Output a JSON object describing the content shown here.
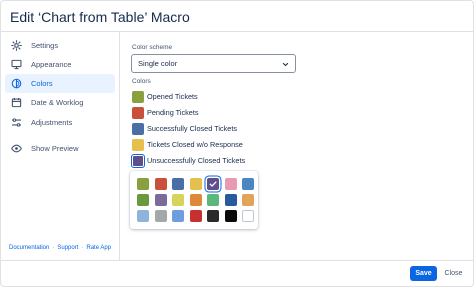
{
  "dialog": {
    "title": "Edit ‘Chart from Table’ Macro"
  },
  "sidebar": {
    "items": [
      {
        "label": "Settings",
        "icon": "gear-icon",
        "active": false
      },
      {
        "label": "Appearance",
        "icon": "monitor-icon",
        "active": false
      },
      {
        "label": "Colors",
        "icon": "palette-icon",
        "active": true
      },
      {
        "label": "Date & Worklog",
        "icon": "calendar-icon",
        "active": false
      },
      {
        "label": "Adjustments",
        "icon": "sliders-icon",
        "active": false
      },
      {
        "label": "Show Preview",
        "icon": "eye-icon",
        "active": false
      }
    ],
    "footer": {
      "documentation": "Documentation",
      "sep": "·",
      "support": "Support",
      "rate": "Rate App"
    }
  },
  "main": {
    "scheme_label": "Color scheme",
    "scheme_value": "Single color",
    "colors_label": "Colors",
    "colors": [
      {
        "label": "Opened Tickets",
        "color": "#8aa03f"
      },
      {
        "label": "Pending Tickets",
        "color": "#c9503a"
      },
      {
        "label": "Successfully Closed Tickets",
        "color": "#4a6fa5"
      },
      {
        "label": "Tickets Closed w/o Response",
        "color": "#e5c04f"
      },
      {
        "label": "Unsuccessfully Closed Tickets",
        "color": "#5e4e8c",
        "selected": true
      }
    ]
  },
  "palette": {
    "rows": [
      [
        "#8aa03f",
        "#c9503a",
        "#4a6fa5",
        "#e5c04f",
        "#5e4e8c",
        "#e89ab3",
        "#4b86c0"
      ],
      [
        "#6b9a3e",
        "#7a6b9b",
        "#d8d35a",
        "#e0883a",
        "#5cb87a",
        "#2a5a9e",
        "#e0a55a"
      ],
      [
        "#8fb4dc",
        "#a5a8ab",
        "#6b9de0",
        "#c8302f",
        "#2a2a2a",
        "#0a0a0a",
        "#ffffff"
      ]
    ],
    "selected_row": 0,
    "selected_col": 4
  },
  "buttons": {
    "save": "Save",
    "close": "Close"
  }
}
